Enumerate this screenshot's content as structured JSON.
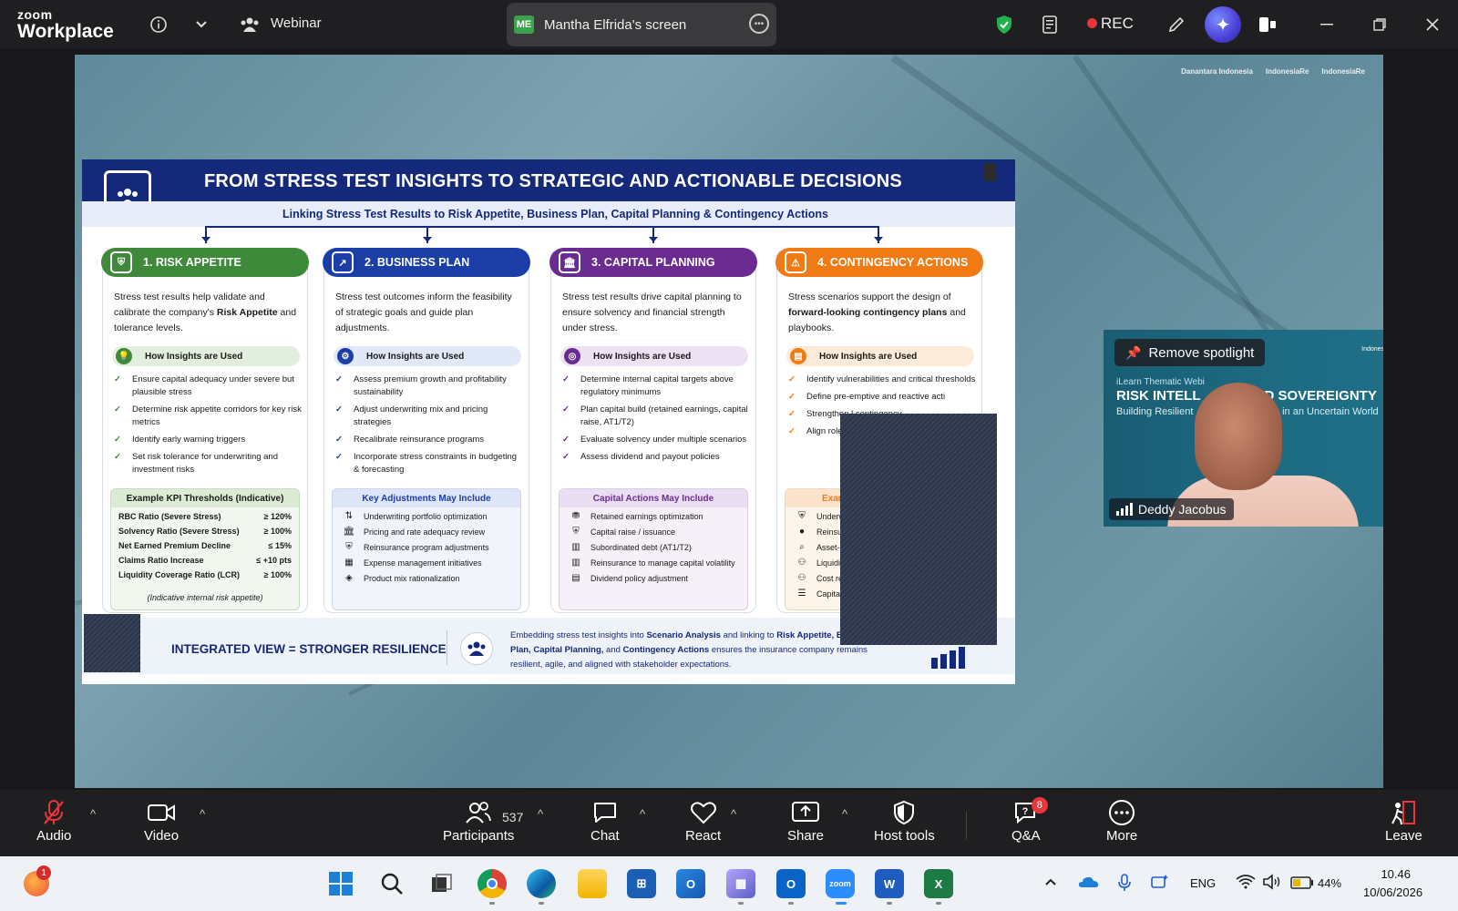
{
  "app": {
    "brand_top": "zoom",
    "brand_bottom": "Workplace",
    "mode_label": "Webinar"
  },
  "share": {
    "avatar": "ME",
    "label": "Mantha Elfrida's screen"
  },
  "titlebar": {
    "rec_label": "REC",
    "icons": [
      "info-icon",
      "chevron-down-icon",
      "webinar-icon",
      "shield-check-icon",
      "notes-icon",
      "record-dot-icon",
      "pen-icon",
      "ai-companion-icon",
      "side-panel-icon",
      "minimize-icon",
      "restore-icon",
      "close-icon"
    ],
    "accent": "#e8363a"
  },
  "slide": {
    "brand_logos": [
      "Danantara Indonesia",
      "IndonesiaRe",
      "IndonesiaRe"
    ],
    "title": "FROM STRESS TEST INSIGHTS TO STRATEGIC AND ACTIONABLE DECISIONS",
    "subtitle": "Linking Stress Test Results to Risk Appetite, Business Plan, Capital Planning & Contingency Actions",
    "columns": [
      {
        "heading": "1. RISK APPETITE",
        "color": "#3f8a3a",
        "desc_a": "Stress test results help validate and calibrate the company's ",
        "desc_b": "Risk Appetite",
        "desc_c": " and tolerance levels.",
        "how": "How Insights are Used",
        "checks": [
          "Ensure capital adequacy under severe but plausible stress",
          "Determine risk appetite corridors for key risk metrics",
          "Identify early warning triggers",
          "Set risk tolerance for underwriting and investment risks"
        ],
        "box_title": "Example KPI Thresholds (Indicative)",
        "kpis": [
          [
            "RBC Ratio (Severe Stress)",
            "≥ 120%"
          ],
          [
            "Solvency Ratio (Severe Stress)",
            "≥ 100%"
          ],
          [
            "Net Earned Premium Decline",
            "≤ 15%"
          ],
          [
            "Claims Ratio Increase",
            "≤ +10 pts"
          ],
          [
            "Liquidity Coverage Ratio (LCR)",
            "≥ 100%"
          ]
        ],
        "note": "(Indicative internal risk appetite)"
      },
      {
        "heading": "2. BUSINESS PLAN",
        "color": "#1b3fa6",
        "desc_a": "Stress test outcomes inform the feasibility of strategic goals and guide plan adjustments.",
        "desc_b": "",
        "desc_c": "",
        "how": "How Insights are Used",
        "checks": [
          "Assess premium growth and profitability sustainability",
          "Adjust underwriting mix and pricing strategies",
          "Recalibrate reinsurance programs",
          "Incorporate stress constraints in budgeting & forecasting"
        ],
        "box_title": "Key Adjustments May Include",
        "actions": [
          "Underwriting portfolio optimization",
          "Pricing and rate adequacy review",
          "Reinsurance program adjustments",
          "Expense management initiatives",
          "Product mix rationalization"
        ]
      },
      {
        "heading": "3. CAPITAL PLANNING",
        "color": "#6b2c91",
        "desc_a": "Stress test results drive capital planning to ensure solvency and financial strength under stress.",
        "desc_b": "",
        "desc_c": "",
        "how": "How Insights are Used",
        "checks": [
          "Determine internal capital targets above regulatory minimums",
          "Plan capital build (retained earnings, capital raise, AT1/T2)",
          "Evaluate solvency under multiple scenarios",
          "Assess dividend and payout policies"
        ],
        "box_title": "Capital Actions May Include",
        "actions": [
          "Retained earnings optimization",
          "Capital raise / issuance",
          "Subordinated debt (AT1/T2)",
          "Reinsurance to manage capital volatility",
          "Dividend policy adjustment"
        ]
      },
      {
        "heading": "4. CONTINGENCY ACTIONS",
        "color": "#f07a14",
        "desc_a": "Stress scenarios support the design of ",
        "desc_b": "forward-looking contingency plans",
        "desc_c": " and playbooks.",
        "how": "How Insights are Used",
        "checks": [
          "Identify vulnerabilities and critical thresholds",
          "Define pre-emptive and reactive acti",
          "Strengthen l contingency",
          "Align roles, t"
        ],
        "box_title": "Example",
        "actions": [
          "Underwrit",
          "Reinsuran",
          "Asset-liabil",
          "Liquidity e",
          "Cost reduc",
          "Capital rai"
        ]
      }
    ],
    "footer_title": "INTEGRATED VIEW = STRONGER RESILIENCE",
    "footer_1": "Embedding stress test insights into ",
    "footer_2": "Scenario Analysis",
    "footer_3": " and linking to ",
    "footer_4": "Risk Appetite,",
    "footer_5": "Business Plan, Capital Planning,",
    "footer_6": " and ",
    "footer_7": "Contingency Actions",
    "footer_8": " ensures the insurance company remains resilient, agile, and aligned with stakeholder expectations."
  },
  "video": {
    "spotlight_label": "Remove spotlight",
    "bg_sub": "iLearn Thematic Webi",
    "bg_title_a": "RISK INTELL",
    "bg_title_b": "D SOVEREIGNTY",
    "bg_tag_a": "Building Resilient",
    "bg_tag_b": "ms in an Uncertain World",
    "name": "Deddy Jacobus"
  },
  "toolbar": {
    "audio": "Audio",
    "video": "Video",
    "participants": "Participants",
    "participant_count": "537",
    "chat": "Chat",
    "react": "React",
    "share": "Share",
    "host_tools": "Host tools",
    "qa": "Q&A",
    "qa_badge": "8",
    "more": "More",
    "leave": "Leave"
  },
  "taskbar": {
    "notif_badge": "1",
    "lang": "ENG",
    "battery": "44%",
    "time": "10.46",
    "date": "10/06/2026"
  }
}
